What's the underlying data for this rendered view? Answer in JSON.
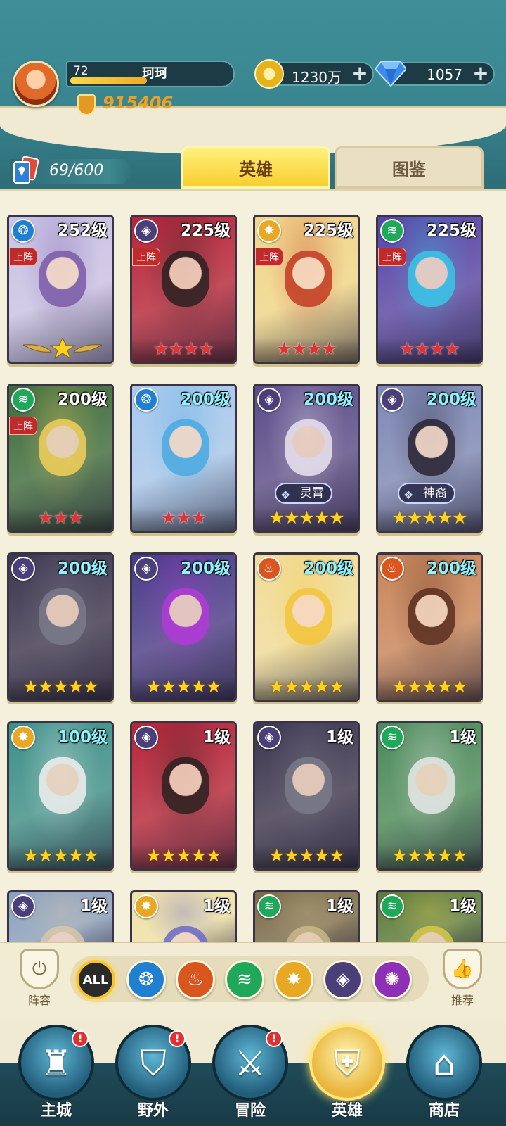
{
  "player": {
    "level": "72",
    "name": "珂珂",
    "xp_fraction": 0.48,
    "power": "915406"
  },
  "resources": {
    "gold": "1230万",
    "gems": "1057",
    "plus_icon": "plus-icon"
  },
  "card_count": "69/600",
  "tabs": [
    {
      "label": "英雄",
      "active": true
    },
    {
      "label": "图鉴",
      "active": false
    }
  ],
  "elements": {
    "water": {
      "color": "#1f7fd0",
      "glyph": "❂",
      "icon": "water-element-icon"
    },
    "fire": {
      "color": "#d9561f",
      "glyph": "♨",
      "icon": "fire-element-icon"
    },
    "wind": {
      "color": "#1fa75a",
      "glyph": "≋",
      "icon": "wind-element-icon"
    },
    "light": {
      "color": "#e9a823",
      "glyph": "✸",
      "icon": "light-element-icon"
    },
    "dark": {
      "color": "#4b3f7a",
      "glyph": "◈",
      "icon": "dark-element-icon"
    },
    "void": {
      "color": "#8e2fb8",
      "glyph": "✺",
      "icon": "void-element-icon"
    }
  },
  "deployed_label": "上阵",
  "heroes": [
    {
      "level": "252级",
      "element": "water",
      "deployed": true,
      "star_count": 1,
      "star_type": "winged",
      "bg": "#c9c3e8",
      "accent": "#7b5aa8",
      "lvl_color": "white"
    },
    {
      "level": "225级",
      "element": "dark",
      "deployed": true,
      "star_count": 4,
      "star_type": "red",
      "bg": "#b7243a",
      "accent": "#2b2020",
      "lvl_color": "white"
    },
    {
      "level": "225级",
      "element": "light",
      "deployed": true,
      "star_count": 4,
      "star_type": "red",
      "bg": "#f2d78a",
      "accent": "#c33a22",
      "lvl_color": "white"
    },
    {
      "level": "225级",
      "element": "wind",
      "deployed": true,
      "star_count": 4,
      "star_type": "red",
      "bg": "#5744a8",
      "accent": "#38c6e8",
      "lvl_color": "white"
    },
    {
      "level": "200级",
      "element": "wind",
      "deployed": true,
      "star_count": 3,
      "star_type": "red",
      "bg": "#3d6b3d",
      "accent": "#f3cf5a",
      "lvl_color": "white"
    },
    {
      "level": "200级",
      "element": "water",
      "deployed": false,
      "star_count": 3,
      "star_type": "red",
      "bg": "#a7c8f0",
      "accent": "#4aa9e0",
      "lvl_color": "cyan"
    },
    {
      "level": "200级",
      "element": "dark",
      "deployed": false,
      "star_count": 5,
      "star_type": "gold",
      "bg": "#5a4b8a",
      "accent": "#e9e4f0",
      "lvl_color": "cyan",
      "title": "灵霄"
    },
    {
      "level": "200级",
      "element": "dark",
      "deployed": false,
      "star_count": 5,
      "star_type": "gold",
      "bg": "#7d88b8",
      "accent": "#2a2333",
      "lvl_color": "cyan",
      "title": "神裔"
    },
    {
      "level": "200级",
      "element": "dark",
      "deployed": false,
      "star_count": 5,
      "star_type": "gold",
      "bg": "#3b3550",
      "accent": "#7a7a8a",
      "lvl_color": "cyan"
    },
    {
      "level": "200级",
      "element": "dark",
      "deployed": false,
      "star_count": 5,
      "star_type": "gold",
      "bg": "#4a3b8a",
      "accent": "#b13ad8",
      "lvl_color": "cyan"
    },
    {
      "level": "200级",
      "element": "fire",
      "deployed": false,
      "star_count": 5,
      "star_type": "gold",
      "bg": "#f1dd9a",
      "accent": "#f3c43a",
      "lvl_color": "cyan"
    },
    {
      "level": "200级",
      "element": "fire",
      "deployed": false,
      "star_count": 5,
      "star_type": "gold",
      "bg": "#c9855a",
      "accent": "#5a2e1f",
      "lvl_color": "cyan"
    },
    {
      "level": "100级",
      "element": "light",
      "deployed": false,
      "star_count": 5,
      "star_type": "gold",
      "bg": "#3c8f8a",
      "accent": "#f0f0f0",
      "lvl_color": "cyan"
    },
    {
      "level": "1级",
      "element": "dark",
      "deployed": false,
      "star_count": 5,
      "star_type": "gold",
      "bg": "#b7243a",
      "accent": "#2b2020",
      "lvl_color": "white"
    },
    {
      "level": "1级",
      "element": "dark",
      "deployed": false,
      "star_count": 5,
      "star_type": "gold",
      "bg": "#3b3550",
      "accent": "#7a7a8a",
      "lvl_color": "white"
    },
    {
      "level": "1级",
      "element": "wind",
      "deployed": false,
      "star_count": 5,
      "star_type": "gold",
      "bg": "#4a8a5a",
      "accent": "#e8e8e8",
      "lvl_color": "white"
    },
    {
      "level": "1级",
      "element": "dark",
      "deployed": false,
      "star_count": 0,
      "star_type": "gold",
      "bg": "#8aa0c0",
      "accent": "#d8c8a8",
      "lvl_color": "white",
      "partial": true
    },
    {
      "level": "1级",
      "element": "light",
      "deployed": false,
      "star_count": 0,
      "star_type": "gold",
      "bg": "#f0e2a8",
      "accent": "#6a6ac8",
      "lvl_color": "white",
      "partial": true
    },
    {
      "level": "1级",
      "element": "wind",
      "deployed": false,
      "star_count": 0,
      "star_type": "gold",
      "bg": "#7a6a4a",
      "accent": "#c8b888",
      "lvl_color": "white",
      "partial": true
    },
    {
      "level": "1级",
      "element": "wind",
      "deployed": false,
      "star_count": 0,
      "star_type": "gold",
      "bg": "#5a7a3a",
      "accent": "#d8c84a",
      "lvl_color": "white",
      "partial": true
    }
  ],
  "filter_bar": {
    "lineup_label": "阵容",
    "recommend_label": "推荐",
    "all_label": "ALL",
    "filters": [
      "water",
      "fire",
      "wind",
      "light",
      "dark",
      "void"
    ]
  },
  "nav": [
    {
      "label": "主城",
      "glyph": "♜",
      "alert": true,
      "active": false
    },
    {
      "label": "野外",
      "glyph": "⛉",
      "alert": true,
      "active": false
    },
    {
      "label": "冒险",
      "glyph": "⚔",
      "alert": true,
      "active": false
    },
    {
      "label": "英雄",
      "glyph": "⛨",
      "alert": false,
      "active": true
    },
    {
      "label": "商店",
      "glyph": "⌂",
      "alert": false,
      "active": false
    }
  ],
  "alert_mark": "!"
}
